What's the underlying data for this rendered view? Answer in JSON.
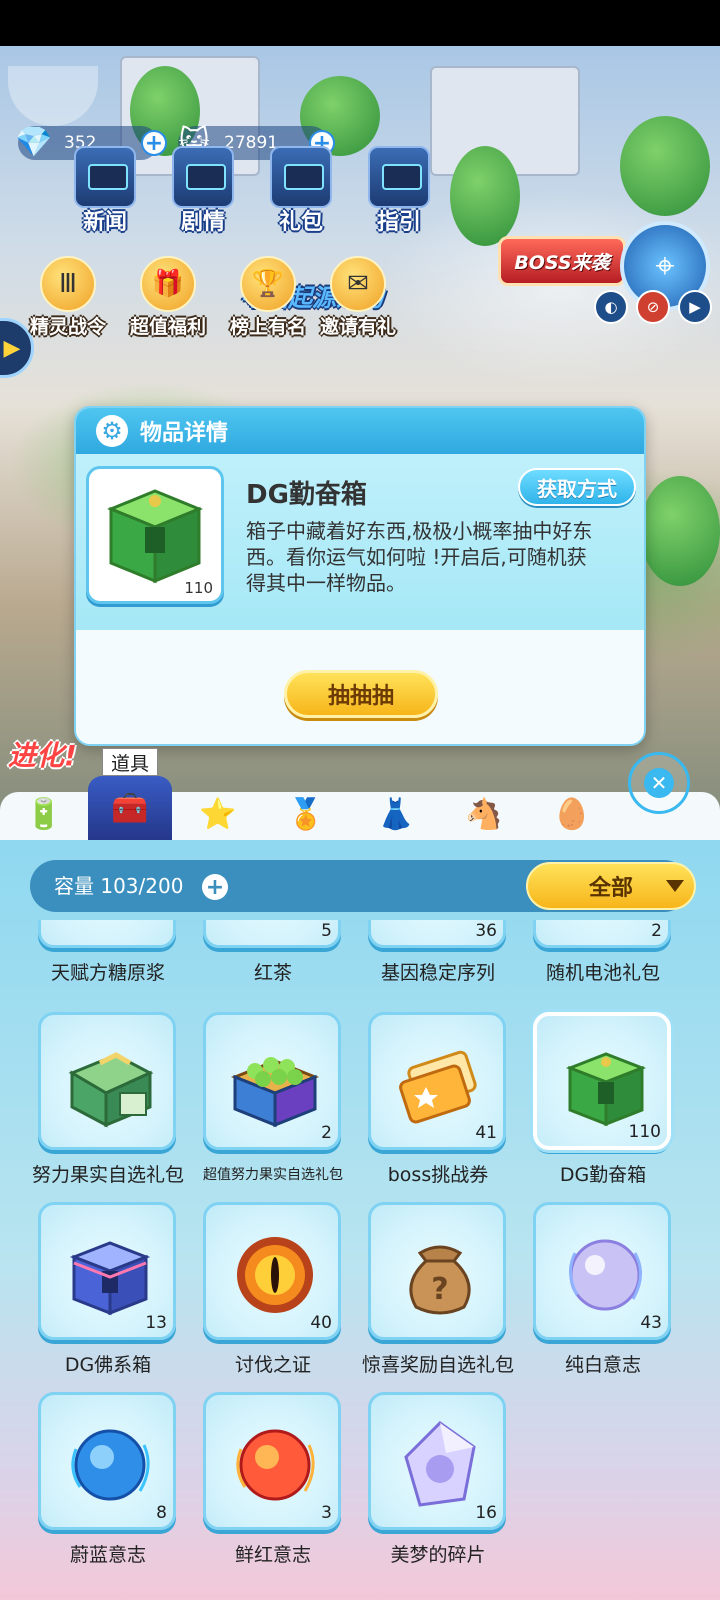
{
  "hud": {
    "diamonds": "352",
    "coins": "27891"
  },
  "top_menu": [
    {
      "label": "新闻"
    },
    {
      "label": "剧情"
    },
    {
      "label": "礼包"
    },
    {
      "label": "指引"
    }
  ],
  "features": [
    {
      "label": "精灵战令"
    },
    {
      "label": "超值福利"
    },
    {
      "label": "榜上有名"
    },
    {
      "label": "邀请有礼"
    }
  ],
  "event": {
    "boss_label": "BOSS来袭",
    "origin_banner": "寻回起源之力",
    "evolve_text": "进化!"
  },
  "detail": {
    "header_title": "物品详情",
    "item_name": "DG勤奋箱",
    "item_count": "110",
    "description": "箱子中藏着好东西,极极小概率抽中好东西。看你运气如何啦 !开启后,可随机获得其中一样物品。",
    "obtain_label": "获取方式",
    "draw_label": "抽抽抽"
  },
  "bag": {
    "active_tab_label": "道具",
    "capacity_label": "容量 103/200",
    "filter_label": "全部",
    "partial_row": [
      {
        "name": "天赋方糖原浆",
        "count": ""
      },
      {
        "name": "红茶",
        "count": "5"
      },
      {
        "name": "基因稳定序列",
        "count": "36"
      },
      {
        "name": "随机电池礼包",
        "count": "2"
      }
    ],
    "items": [
      {
        "name": "努力果实自选礼包",
        "count": ""
      },
      {
        "name": "超值努力果实自选礼包",
        "count": "2"
      },
      {
        "name": "boss挑战券",
        "count": "41"
      },
      {
        "name": "DG勤奋箱",
        "count": "110"
      },
      {
        "name": "DG佛系箱",
        "count": "13"
      },
      {
        "name": "讨伐之证",
        "count": "40"
      },
      {
        "name": "惊喜奖励自选礼包",
        "count": ""
      },
      {
        "name": "纯白意志",
        "count": "43"
      },
      {
        "name": "蔚蓝意志",
        "count": "8"
      },
      {
        "name": "鲜红意志",
        "count": "3"
      },
      {
        "name": "美梦的碎片",
        "count": "16"
      }
    ]
  }
}
